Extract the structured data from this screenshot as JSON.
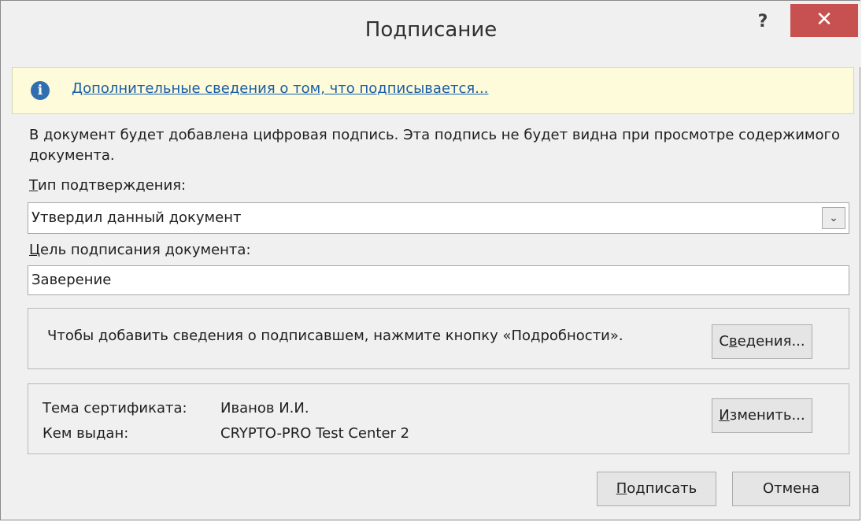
{
  "window": {
    "title": "Подписание",
    "help_label": "?",
    "close_label": "✕"
  },
  "infobar": {
    "icon": "info-icon",
    "link_text": "Дополнительные сведения о том, что подписывается..."
  },
  "description": "В документ будет добавлена цифровая подпись. Эта подпись не будет видна при просмотре содержимого документа.",
  "commitment_type": {
    "label_accel": "Т",
    "label_rest": "ип подтверждения:",
    "value": "Утвердил данный документ"
  },
  "purpose": {
    "label_accel": "Ц",
    "label_rest": "ель подписания документа:",
    "value": "Заверение"
  },
  "signer_details": {
    "text": "Чтобы добавить сведения о подписавшем, нажмите кнопку «Подробности».",
    "button_pre": "С",
    "button_accel": "в",
    "button_rest": "едения..."
  },
  "certificate": {
    "subject_label": "Тема сертификата:",
    "subject_value": "Иванов И.И.",
    "issuer_label": "Кем выдан:",
    "issuer_value": "CRYPTO-PRO Test Center 2",
    "change_accel": "И",
    "change_rest": "зменить..."
  },
  "footer": {
    "sign_accel": "П",
    "sign_rest": "одписать",
    "cancel_label": "Отмена"
  },
  "colors": {
    "close_button": "#c75050",
    "infobar_bg": "#fdfbd9",
    "link": "#1a5ea8"
  }
}
